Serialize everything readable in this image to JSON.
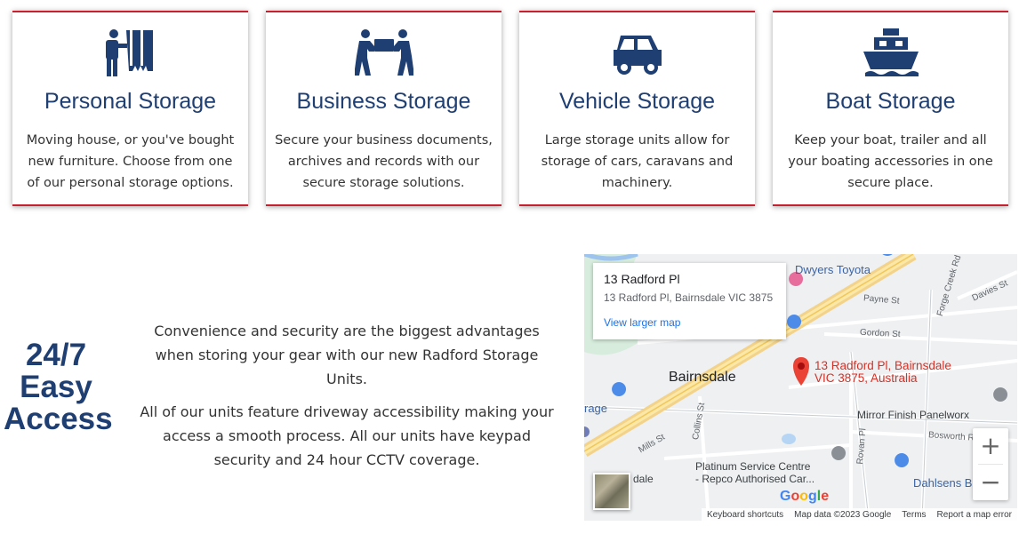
{
  "services": [
    {
      "title": "Personal Storage",
      "icon": "mover-icon",
      "text": "Moving house, or you've bought new furniture. Choose from one of our personal storage options."
    },
    {
      "title": "Business Storage",
      "icon": "carrying-box-icon",
      "text": "Secure your business documents, archives and records with our secure storage solutions."
    },
    {
      "title": "Vehicle Storage",
      "icon": "car-icon",
      "text": "Large storage units allow for storage of cars, caravans and machinery."
    },
    {
      "title": "Boat Storage",
      "icon": "ship-icon",
      "text": "Keep your boat, trailer and all your boating accessories in one secure place."
    }
  ],
  "access": {
    "title_line1": "24/7",
    "title_line2": "Easy",
    "title_line3": "Access",
    "paragraph1": "Convenience and security are the biggest advantages when storing your gear with our new Radford Storage Units.",
    "paragraph2": "All of our units feature driveway accessibility making your access a smooth process. All our units have keypad security and 24 hour CCTV coverage."
  },
  "map": {
    "info_title": "13 Radford Pl",
    "info_address": "13 Radford Pl, Bairnsdale VIC 3875",
    "info_link": "View larger map",
    "marker_label_line1": "13 Radford Pl, Bairnsdale",
    "marker_label_line2": "VIC 3875, Australia",
    "labels": {
      "dwyers": "Dwyers Toyota",
      "forge_creek": "Forge Creek Rd",
      "davies": "Davies St",
      "payne": "Payne St",
      "gordon": "Gordon St",
      "bairnsdale": "Bairnsdale",
      "rage": "rage",
      "collins": "Collins St",
      "mills": "Mills St",
      "mirror": "Mirror Finish Panelworx",
      "bosworth": "Bosworth R",
      "dale": "dale",
      "platinum1": "Platinum Service Centre",
      "platinum2": "- Repco Authorised Car...",
      "rovan": "Rovan Pl",
      "dahlsens": "Dahlsens B"
    },
    "google": "Google",
    "attrib": {
      "shortcuts": "Keyboard shortcuts",
      "data": "Map data ©2023 Google",
      "terms": "Terms",
      "report": "Report a map error"
    },
    "zoom_in": "+",
    "zoom_out": "−"
  },
  "colors": {
    "accent_red": "#c8202f",
    "brand_navy": "#1f3f73"
  }
}
